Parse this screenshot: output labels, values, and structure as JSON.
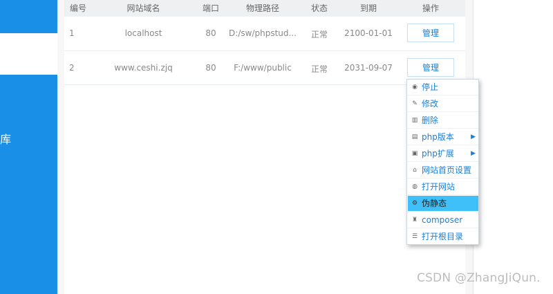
{
  "sidebar": {
    "partial_label": "库"
  },
  "table": {
    "headers": [
      "编号",
      "网站域名",
      "端口",
      "物理路径",
      "状态",
      "到期",
      "操作"
    ],
    "rows": [
      {
        "id": "1",
        "domain": "localhost",
        "port": "80",
        "path": "D:/sw/phpstud...",
        "status": "正常",
        "expire": "2100-01-01",
        "action": "管理"
      },
      {
        "id": "2",
        "domain": "www.ceshi.zjq",
        "port": "80",
        "path": "F:/www/public",
        "status": "正常",
        "expire": "2031-09-07",
        "action": "管理"
      }
    ]
  },
  "context_menu": {
    "items": [
      {
        "label": "停止",
        "icon": "stop-icon"
      },
      {
        "label": "修改",
        "icon": "pencil-icon"
      },
      {
        "label": "删除",
        "icon": "trash-icon"
      },
      {
        "label": "php版本",
        "icon": "php-version-icon",
        "submenu": true
      },
      {
        "label": "php扩展",
        "icon": "php-extension-icon",
        "submenu": true
      },
      {
        "label": "网站首页设置",
        "icon": "home-icon"
      },
      {
        "label": "打开网站",
        "icon": "globe-icon"
      },
      {
        "label": "伪静态",
        "icon": "gear-icon",
        "active": true
      },
      {
        "label": "composer",
        "icon": "composer-icon"
      },
      {
        "label": "打开根目录",
        "icon": "list-icon"
      }
    ]
  },
  "watermark": "CSDN @ZhangJiQun.",
  "colors": {
    "sidebar": "#1a8fe8",
    "accent": "#1a7fd6",
    "menu_active": "#3fc0f8"
  }
}
